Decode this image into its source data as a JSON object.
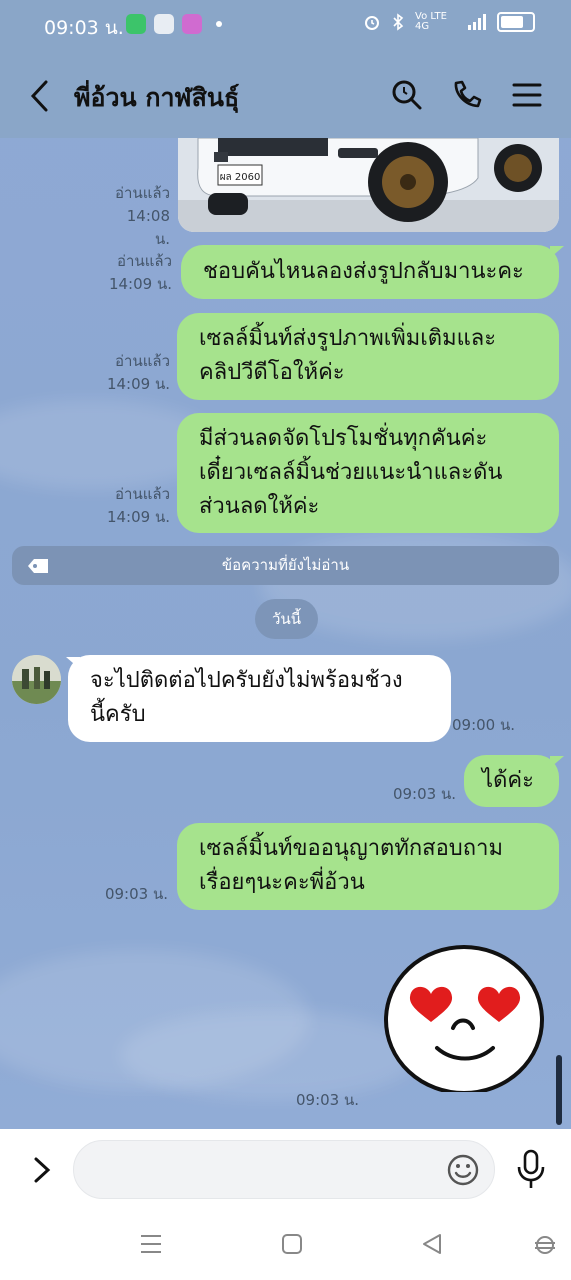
{
  "status": {
    "time": "09:03 น.",
    "right_text": "Vo LTE 4G"
  },
  "header": {
    "title": "พี่อ้วน กาฬสินธุ์"
  },
  "messages": [
    {
      "read": "อ่านแล้ว",
      "time": "14:08 น."
    },
    {
      "read": "อ่านแล้ว",
      "time": "14:09 น.",
      "text": "ชอบคันไหนลองส่งรูปกลับมานะคะ"
    },
    {
      "read": "อ่านแล้ว",
      "time": "14:09 น.",
      "text": "เซลล์มิ้นท์ส่งรูปภาพเพิ่มเติมและคลิปวีดีโอให้ค่ะ",
      "line1": "เซลล์มิ้นท์ส่งรูปภาพเพิ่มเติมและ",
      "line2": "คลิปวีดีโอให้ค่ะ"
    },
    {
      "read": "อ่านแล้ว",
      "time": "14:09 น.",
      "line1": "มีส่วนลดจัดโปรโมชั่นทุกคันค่ะ",
      "line2": "เดี๋ยวเซลล์มิ้นช่วยแนะนำและดัน",
      "line3": "ส่วนลดให้ค่ะ"
    }
  ],
  "plate": "ผล 2060",
  "unread_label": "ข้อความที่ยังไม่อ่าน",
  "date_label": "วันนี้",
  "incoming": {
    "line1": "จะไปติดต่อไปครับยังไม่พร้อมช้วง",
    "line2": "นี้ครับ",
    "time": "09:00 น."
  },
  "outgoing": [
    {
      "text": "ได้ค่ะ",
      "time": "09:03 น."
    },
    {
      "line1": "เซลล์มิ้นท์ขออนุญาตทักสอบถาม",
      "line2": "เรื่อยๆนะคะพี่อ้วน",
      "time": "09:03 น."
    }
  ],
  "sticker": {
    "icon": "heart-eyes-emoji",
    "time": "09:03 น."
  },
  "input": {
    "placeholder": ""
  }
}
